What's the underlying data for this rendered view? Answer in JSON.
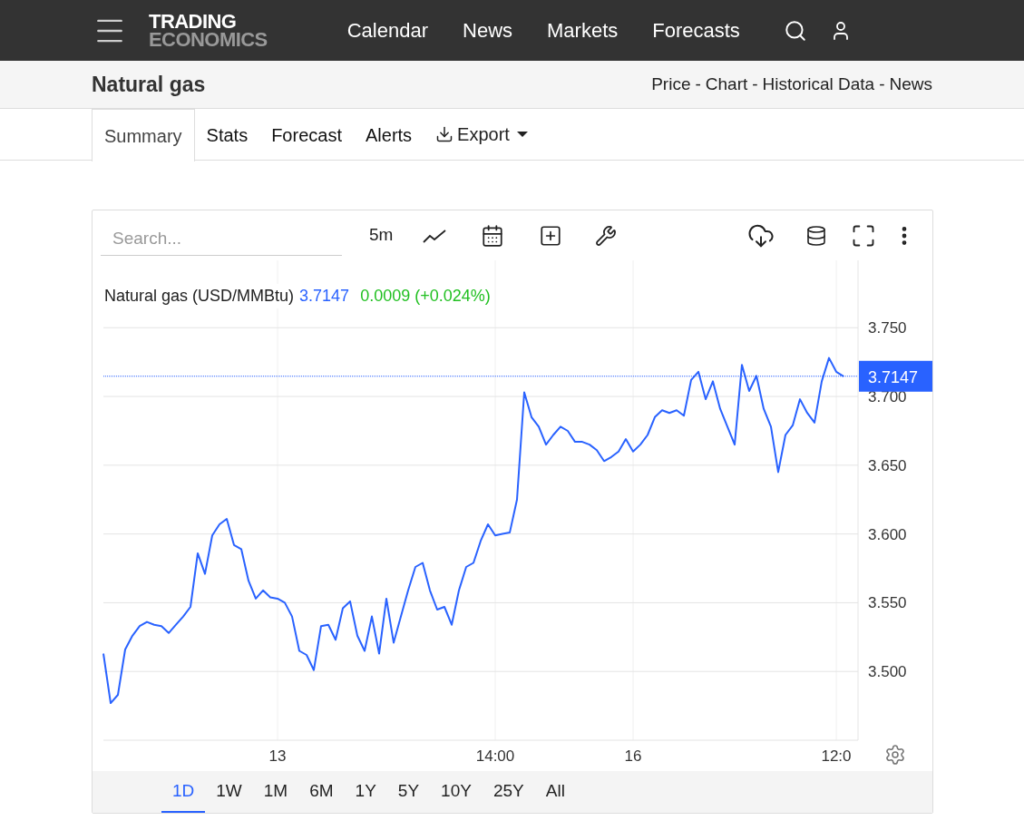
{
  "header": {
    "logo": [
      "TRADING",
      "ECONOMICS"
    ],
    "nav": [
      "Calendar",
      "News",
      "Markets",
      "Forecasts"
    ]
  },
  "title_bar": {
    "title": "Natural gas",
    "links": [
      "Price",
      "Chart",
      "Historical Data",
      "News"
    ],
    "separator": "-"
  },
  "tabs": [
    {
      "label": "Summary",
      "selected": true,
      "kind": "tab"
    },
    {
      "label": "Stats",
      "selected": false,
      "kind": "tab"
    },
    {
      "label": "Forecast",
      "selected": false,
      "kind": "tab"
    },
    {
      "label": "Alerts",
      "selected": false,
      "kind": "tab"
    },
    {
      "label": "Export",
      "selected": false,
      "kind": "menu"
    }
  ],
  "chart_panel": {
    "search": {
      "placeholder": "Search..."
    },
    "interval": "5m",
    "legend": {
      "unit": "(USD/MMBtu)",
      "price": "3.7147",
      "change": "0.0009 (+0.024%)"
    },
    "ranges": [
      {
        "label": "1D",
        "selected": true
      },
      {
        "label": "1W",
        "selected": false
      },
      {
        "label": "1M",
        "selected": false
      },
      {
        "label": "6M",
        "selected": false
      },
      {
        "label": "1Y",
        "selected": false
      },
      {
        "label": "5Y",
        "selected": false
      },
      {
        "label": "10Y",
        "selected": false
      },
      {
        "label": "25Y",
        "selected": false
      },
      {
        "label": "All",
        "selected": false
      }
    ],
    "chart_data": {
      "type": "line",
      "ylim": [
        3.45,
        3.799
      ],
      "grid": true,
      "categories": [
        null,
        null,
        null,
        null,
        null,
        null,
        null,
        null,
        null,
        null,
        null,
        null,
        null,
        null,
        null,
        null,
        null,
        null,
        null,
        null,
        null,
        null,
        null,
        null,
        "13",
        null,
        null,
        null,
        null,
        null,
        null,
        null,
        null,
        null,
        null,
        null,
        null,
        null,
        null,
        null,
        null,
        null,
        null,
        null,
        null,
        null,
        null,
        null,
        null,
        null,
        null,
        null,
        null,
        null,
        "14:00",
        null,
        null,
        null,
        null,
        null,
        null,
        null,
        null,
        null,
        null,
        null,
        null,
        null,
        null,
        null,
        null,
        null,
        null,
        "16",
        null,
        null,
        null,
        null,
        null,
        null,
        null,
        null,
        null,
        null,
        null,
        null,
        null,
        null,
        null,
        null,
        null,
        null,
        null,
        null,
        null,
        null,
        null,
        null,
        null,
        null,
        null,
        "12:0",
        null
      ],
      "ref_lines": [
        {
          "axis": "y",
          "value": 3.7147,
          "label": "3.7147",
          "color": "#2962ff"
        }
      ],
      "yticks": [
        {
          "value": 3.5,
          "label": "3.500"
        },
        {
          "value": 3.55,
          "label": "3.550"
        },
        {
          "value": 3.6,
          "label": "3.600"
        },
        {
          "value": 3.65,
          "label": "3.650"
        },
        {
          "value": 3.7,
          "label": "3.700"
        },
        {
          "value": 3.75,
          "label": "3.750"
        }
      ],
      "series": [
        {
          "name": "Natural gas",
          "color": "#2962ff",
          "values": [
            3.513,
            3.477,
            3.483,
            3.516,
            3.526,
            3.533,
            3.536,
            3.534,
            3.533,
            3.528,
            3.534,
            3.54,
            3.547,
            3.586,
            3.571,
            3.599,
            3.607,
            3.611,
            3.592,
            3.589,
            3.566,
            3.553,
            3.559,
            3.554,
            3.553,
            3.55,
            3.54,
            3.515,
            3.512,
            3.501,
            3.533,
            3.534,
            3.523,
            3.546,
            3.551,
            3.526,
            3.515,
            3.54,
            3.513,
            3.553,
            3.521,
            3.54,
            3.559,
            3.576,
            3.579,
            3.559,
            3.545,
            3.547,
            3.534,
            3.559,
            3.576,
            3.579,
            3.595,
            3.607,
            3.599,
            3.6,
            3.601,
            3.625,
            3.703,
            3.685,
            3.678,
            3.665,
            3.672,
            3.678,
            3.675,
            3.667,
            3.667,
            3.665,
            3.661,
            3.653,
            3.656,
            3.66,
            3.669,
            3.66,
            3.665,
            3.672,
            3.685,
            3.69,
            3.688,
            3.69,
            3.686,
            3.712,
            3.718,
            3.698,
            3.711,
            3.691,
            3.678,
            3.665,
            3.723,
            3.704,
            3.715,
            3.691,
            3.678,
            3.645,
            3.672,
            3.679,
            3.698,
            3.688,
            3.681,
            3.711,
            3.728,
            3.718,
            3.7147
          ]
        }
      ]
    }
  }
}
